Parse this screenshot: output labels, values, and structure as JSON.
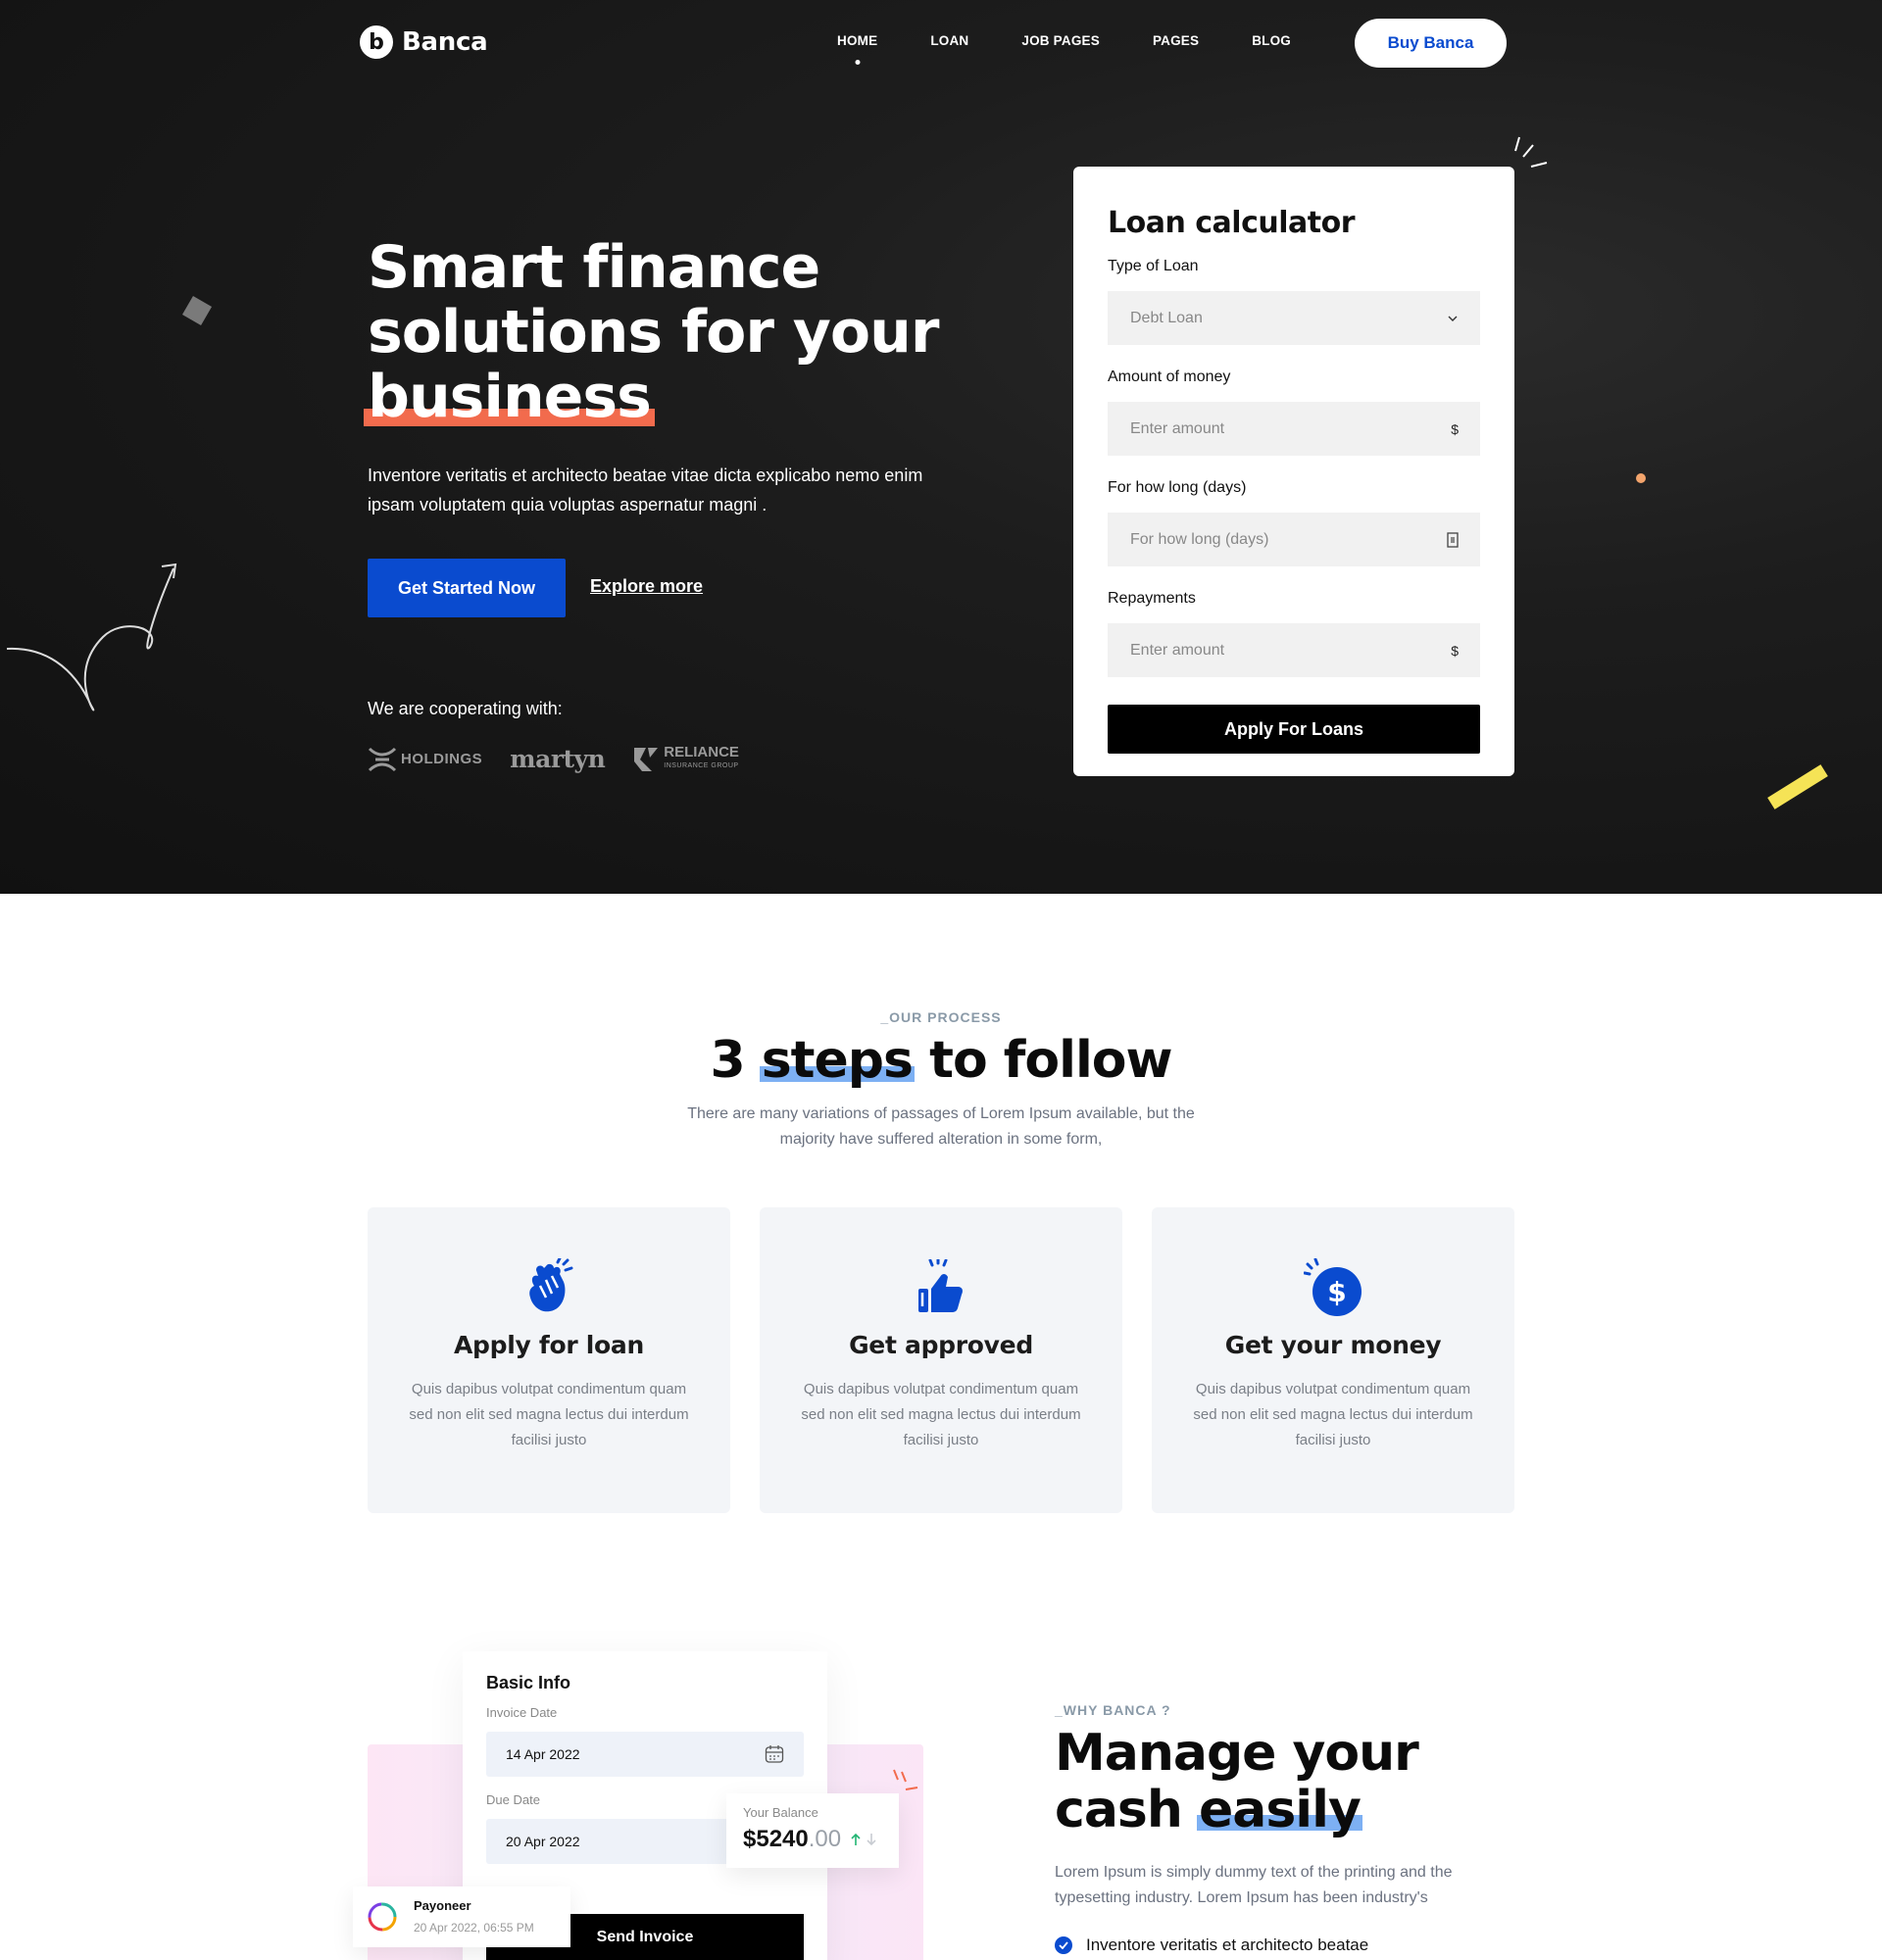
{
  "nav": {
    "logo_letter": "b",
    "logo_text": "Banca",
    "items": [
      {
        "label": "HOME"
      },
      {
        "label": "LOAN"
      },
      {
        "label": "JOB PAGES"
      },
      {
        "label": "PAGES"
      },
      {
        "label": "BLOG"
      }
    ],
    "buy_label": "Buy Banca"
  },
  "hero": {
    "title_line1": "Smart finance",
    "title_line2": "solutions for your",
    "title_line3": "business",
    "description": "Inventore veritatis et architecto beatae vitae dicta explicabo nemo enim ipsam voluptatem quia voluptas aspernatur magni .",
    "cta_label": "Get Started Now",
    "explore_label": "Explore more",
    "cooperating_label": "We are cooperating with:",
    "partners": {
      "p1": "HOLDINGS",
      "p2": "martyn",
      "p3": "RELIANCE",
      "p3_sub": "INSURANCE GROUP"
    }
  },
  "loan_calculator": {
    "title": "Loan calculator",
    "type_label": "Type of Loan",
    "type_value": "Debt Loan",
    "amount_label": "Amount of money",
    "amount_placeholder": "Enter amount",
    "amount_suffix": "$",
    "duration_label": "For how long (days)",
    "duration_placeholder": "For how long (days)",
    "repay_label": "Repayments",
    "repay_placeholder": "Enter amount",
    "repay_suffix": "$",
    "apply_label": "Apply For Loans"
  },
  "process": {
    "eyebrow": "_OUR PROCESS",
    "title_pre": "3 ",
    "title_hl": "steps",
    "title_post": " to follow",
    "subtitle": "There are many variations of passages of Lorem Ipsum available, but the majority have suffered alteration in some form,",
    "steps": [
      {
        "icon": "clapping-hands-icon",
        "title": "Apply for loan",
        "text": "Quis dapibus volutpat condimentum quam sed non elit sed magna lectus dui interdum facilisi justo"
      },
      {
        "icon": "thumbs-up-icon",
        "title": "Get approved",
        "text": "Quis dapibus volutpat condimentum quam sed non elit sed magna lectus dui interdum facilisi justo"
      },
      {
        "icon": "dollar-coin-icon",
        "title": "Get your money",
        "text": "Quis dapibus volutpat condimentum quam sed non elit sed magna lectus dui interdum facilisi justo"
      }
    ]
  },
  "why": {
    "eyebrow": "_WHY BANCA ?",
    "title_line1": "Manage your",
    "title_line2_pre": "cash ",
    "title_line2_hl": "easily",
    "description": "Lorem Ipsum is simply dummy text of the printing and the typesetting industry. Lorem Ipsum has been industry's",
    "check_item": "Inventore veritatis et architecto beatae",
    "invoice": {
      "title": "Basic Info",
      "invoice_date_label": "Invoice Date",
      "invoice_date": "14 Apr 2022",
      "due_date_label": "Due Date",
      "due_date": "20 Apr 2022",
      "send_label": "Send Invoice"
    },
    "balance": {
      "label": "Your Balance",
      "amount_main": "$5240",
      "amount_dec": ".00"
    },
    "payoneer": {
      "name": "Payoneer",
      "date": "20 Apr 2022, 06:55 PM"
    }
  },
  "colors": {
    "brand_blue": "#0a4bcf",
    "highlight_orange": "#f26b4d",
    "highlight_blue": "#5d9cf0",
    "hero_bg": "#1a1a1a"
  }
}
